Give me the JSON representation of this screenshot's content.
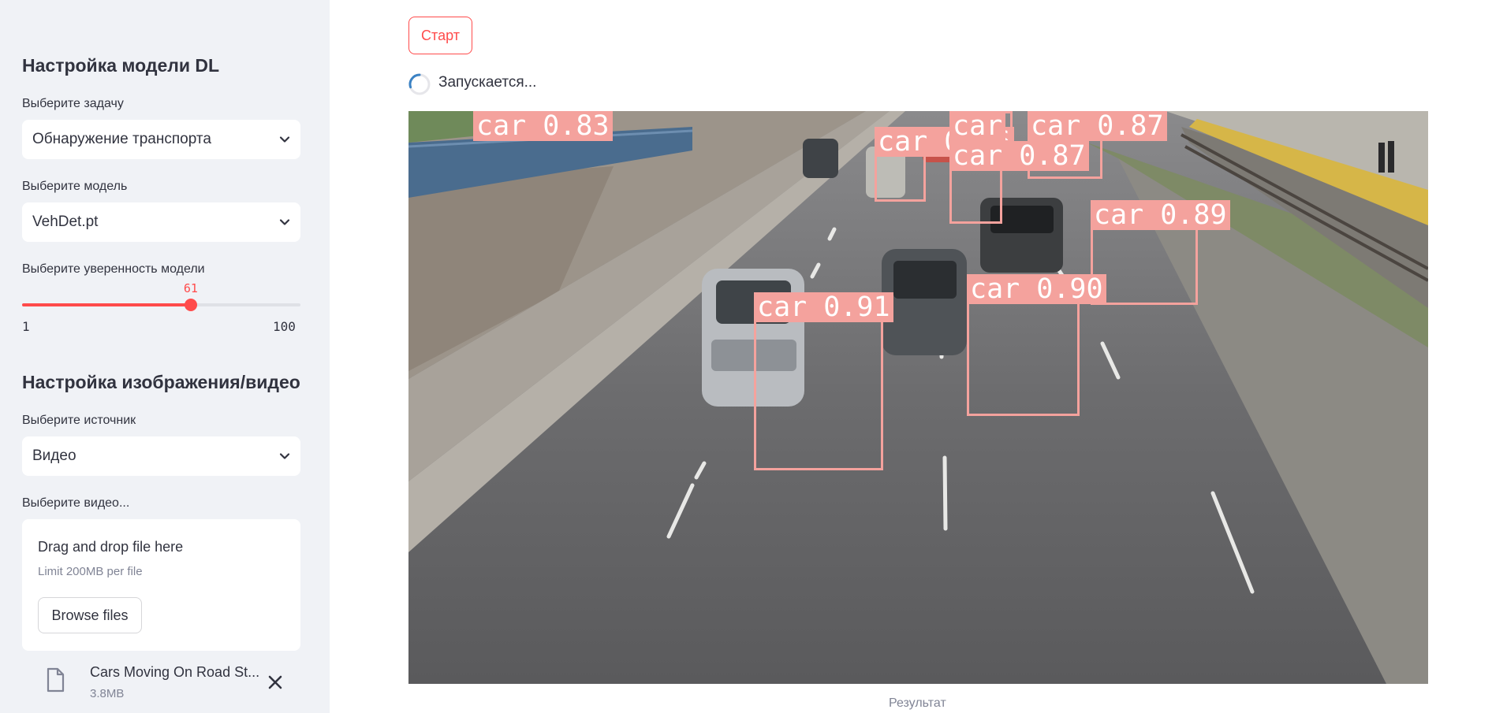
{
  "sidebar": {
    "model_section": {
      "title": "Настройка модели DL",
      "task_label": "Выберите задачу",
      "task_value": "Обнаружение транспорта",
      "model_label": "Выберите модель",
      "model_value": "VehDet.pt",
      "confidence_label": "Выберите уверенность модели",
      "confidence": {
        "value": 61,
        "value_text": "61",
        "min": 1,
        "min_text": "1",
        "max": 100,
        "max_text": "100"
      }
    },
    "media_section": {
      "title": "Настройка изображения/видео",
      "source_label": "Выберите источник",
      "source_value": "Видео",
      "video_label": "Выберите видео...",
      "uploader": {
        "drop_text": "Drag and drop file here",
        "limit_text": "Limit 200MB per file",
        "browse_label": "Browse files"
      },
      "uploaded_file": {
        "name": "Cars Moving On Road St...",
        "size": "3.8MB"
      }
    }
  },
  "main": {
    "start_label": "Старт",
    "status_text": "Запускается...",
    "caption": "Результат",
    "detections": [
      {
        "label": "car 0.83"
      },
      {
        "label": "car 0.86"
      },
      {
        "label": "car"
      },
      {
        "label": "car 0.87"
      },
      {
        "label": "car 0.87"
      },
      {
        "label": "car 0.89"
      },
      {
        "label": "car 0.91"
      },
      {
        "label": "car 0.90"
      }
    ]
  },
  "colors": {
    "accent": "#ff4b4b",
    "sidebar_bg": "#f0f2f6",
    "detection": "#f4a29d"
  },
  "icons": {
    "select_arrow": "chevron-down-icon",
    "file": "file-icon",
    "remove": "close-icon",
    "loading": "spinner-icon"
  }
}
